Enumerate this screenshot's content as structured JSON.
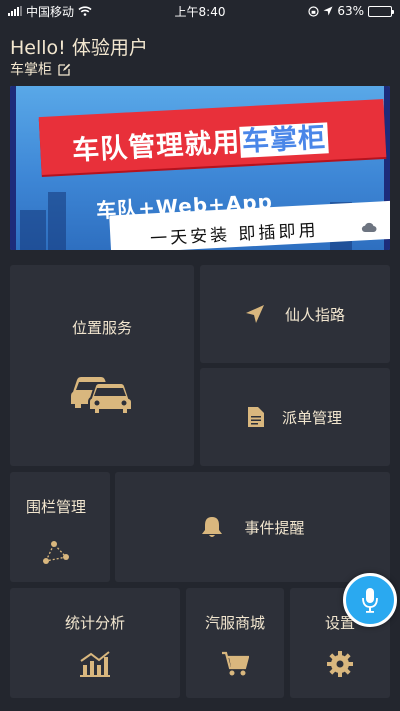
{
  "status_bar": {
    "carrier": "中国移动",
    "time": "上午8:40",
    "battery": "63%",
    "battery_level": 0.63
  },
  "header": {
    "greeting": "Hello!  体验用户",
    "subtitle": "车掌柜"
  },
  "banner": {
    "title_main": "车队管理就用",
    "title_brand": "车掌柜",
    "line2": "车队+Web+App",
    "line3": "一天安装 即插即用"
  },
  "tiles": {
    "location": "位置服务",
    "guide": "仙人指路",
    "dispatch": "派单管理",
    "fence": "围栏管理",
    "events": "事件提醒",
    "stats": "统计分析",
    "mall": "汽服商城",
    "settings": "设置"
  },
  "colors": {
    "background": "#23262e",
    "tile": "#2d3039",
    "accent_gold": "#d9b77e",
    "text": "#f2e6cf",
    "mic_blue": "#2aa9f0"
  }
}
